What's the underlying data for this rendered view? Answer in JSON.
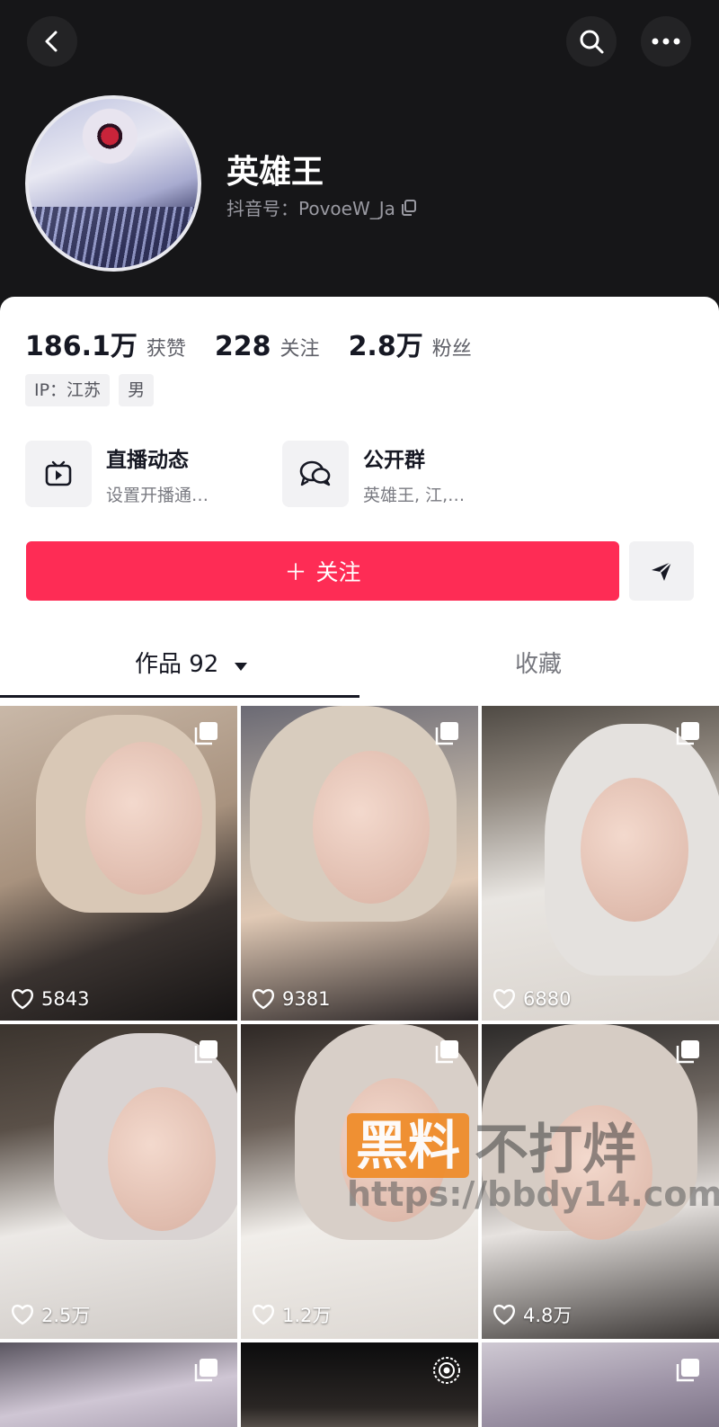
{
  "profile": {
    "nickname": "英雄王",
    "douyin_id": "抖音号：PovoeW_Ja"
  },
  "stats": [
    {
      "value": "186.1万",
      "label": "获赞"
    },
    {
      "value": "228",
      "label": "关注"
    },
    {
      "value": "2.8万",
      "label": "粉丝"
    }
  ],
  "tags": [
    "IP：江苏",
    "男"
  ],
  "features": [
    {
      "title": "直播动态",
      "subtitle": "设置开播通…",
      "icon": "tv-icon"
    },
    {
      "title": "公开群",
      "subtitle": "英雄王, 江,…",
      "icon": "chat-group-icon"
    }
  ],
  "actions": {
    "follow_label": "关注",
    "follow_prefix": "＋"
  },
  "tabs": {
    "works_label": "作品 92",
    "favorites_label": "收藏"
  },
  "videos": [
    {
      "likes": "5843",
      "badge": "multi-image-icon"
    },
    {
      "likes": "9381",
      "badge": "multi-image-icon"
    },
    {
      "likes": "6880",
      "badge": "multi-image-icon"
    },
    {
      "likes": "2.5万",
      "badge": "multi-image-icon"
    },
    {
      "likes": "1.2万",
      "badge": "multi-image-icon"
    },
    {
      "likes": "4.8万",
      "badge": "multi-image-icon"
    },
    {
      "likes": "",
      "badge": "multi-image-icon"
    },
    {
      "likes": "",
      "badge": "live-icon"
    },
    {
      "likes": "",
      "badge": "multi-image-icon"
    }
  ],
  "watermark": {
    "brand_box": "黑料",
    "brand_text": "不打烊",
    "url": "https://bbdy14.com"
  },
  "colors": {
    "accent": "#fe2c55",
    "header_bg": "#161618"
  }
}
